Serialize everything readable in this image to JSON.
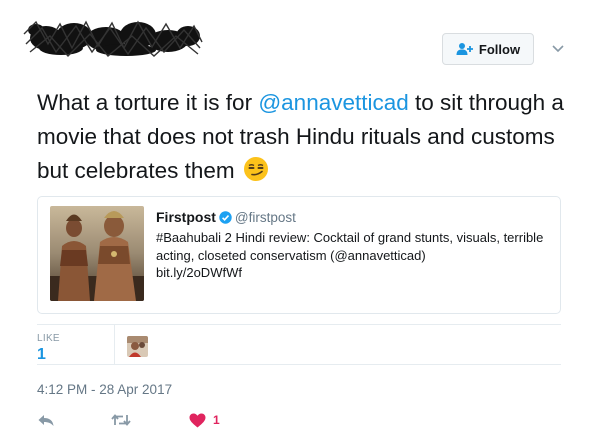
{
  "header": {
    "follow_label": "Follow"
  },
  "tweet": {
    "text_before": "What a torture it is for ",
    "mention": "@annavetticad",
    "text_after": " to sit through a movie that does not trash Hindu rituals and customs but celebrates them ",
    "emoji": "smirking-face-emoji"
  },
  "quoted": {
    "name": "Firstpost",
    "verified": true,
    "handle": "@firstpost",
    "body": "#Baahubali 2 Hindi review: Cocktail of grand stunts, visuals, terrible acting, closeted conservatism (@annavetticad)",
    "link": "bit.ly/2oDWfWf"
  },
  "stats": {
    "likes_label": "LIKE",
    "likes_count": "1"
  },
  "timestamp": "4:12 PM - 28 Apr 2017",
  "actions": {
    "like_count": "1"
  },
  "colors": {
    "mention": "#1b95e0",
    "like": "#e0245e",
    "muted": "#657786",
    "border": "#e1e8ed"
  }
}
